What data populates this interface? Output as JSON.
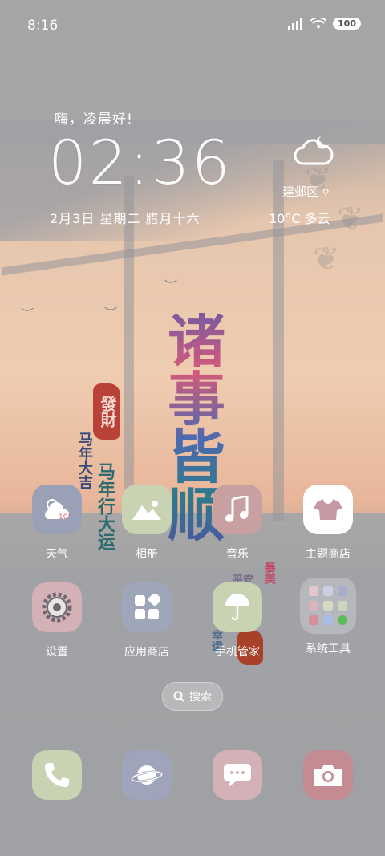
{
  "status_bar": {
    "time": "8:16",
    "battery": "100",
    "icons": [
      "signal-icon",
      "wifi-icon",
      "battery-icon"
    ]
  },
  "widget": {
    "greeting": "嗨，凌晨好!",
    "clock": "02:36",
    "date": "2月3日  星期二  腊月十六",
    "location": "建邺区",
    "weather": "10°C  多云",
    "weather_icon": "cloudy-night-icon"
  },
  "wallpaper": {
    "main_text": [
      "诸",
      "事",
      "皆",
      "顺"
    ],
    "seal_text": "發財",
    "side_1": "马年大吉",
    "side_2": "马年行大运",
    "side_3": "暴美",
    "side_4": "平安",
    "side_5": "幸运"
  },
  "apps_row1": [
    {
      "label": "天气",
      "icon": "weather-icon",
      "color": "#9aa0b6"
    },
    {
      "label": "相册",
      "icon": "gallery-icon",
      "color": "#c8d3b4"
    },
    {
      "label": "音乐",
      "icon": "music-icon",
      "color": "#c9a0a2"
    },
    {
      "label": "主题商店",
      "icon": "theme-store-icon",
      "color": "#ffffff"
    }
  ],
  "apps_row2": [
    {
      "label": "设置",
      "icon": "settings-icon",
      "color": "#d4b1b6"
    },
    {
      "label": "应用商店",
      "icon": "app-store-icon",
      "color": "#a0a6ba"
    },
    {
      "label": "手机管家",
      "icon": "phone-manager-icon",
      "color": "#c8d3b4"
    },
    {
      "label": "系统工具",
      "icon": "folder-icon",
      "color": "#b6b8bd"
    }
  ],
  "search": {
    "label": "搜索"
  },
  "dock": [
    {
      "name": "phone",
      "icon": "phone-icon",
      "color": "#c9d2b2"
    },
    {
      "name": "browser",
      "icon": "browser-icon",
      "color": "#a0a4ba"
    },
    {
      "name": "messages",
      "icon": "message-icon",
      "color": "#d4b1b6"
    },
    {
      "name": "camera",
      "icon": "camera-icon",
      "color": "#c48b92"
    }
  ]
}
